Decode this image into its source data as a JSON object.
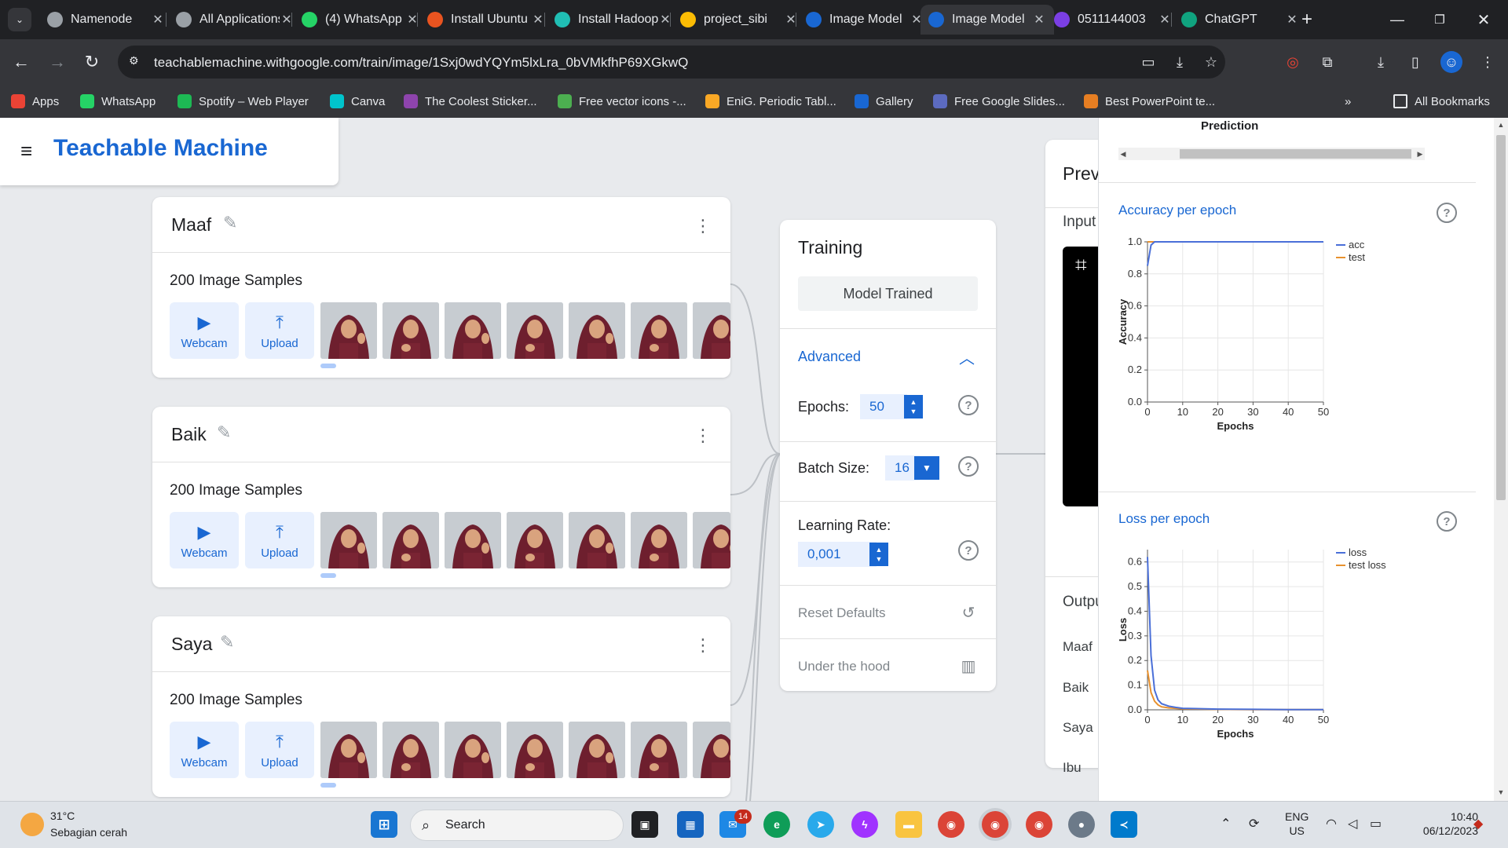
{
  "browser": {
    "tabs": [
      {
        "title": "Namenode",
        "favicon": "globe-icon",
        "color": "#9aa0a6"
      },
      {
        "title": "All Applications",
        "favicon": "globe-icon",
        "color": "#9aa0a6"
      },
      {
        "title": "(4) WhatsApp",
        "favicon": "whatsapp-icon",
        "color": "#25d366"
      },
      {
        "title": "Install Ubuntu",
        "favicon": "ubuntu-icon",
        "color": "#e95420"
      },
      {
        "title": "Install Hadoop",
        "favicon": "k-icon",
        "color": "#20beb4"
      },
      {
        "title": "project_sibi",
        "favicon": "drive-icon",
        "color": "#fbbc04"
      },
      {
        "title": "Image Model",
        "favicon": "tm-icon",
        "color": "#1967d2"
      },
      {
        "title": "Image Model",
        "favicon": "tm-icon",
        "color": "#1967d2"
      },
      {
        "title": "0511144003",
        "favicon": "plus-icon",
        "color": "#7b3fe4"
      },
      {
        "title": "ChatGPT",
        "favicon": "chatgpt-icon",
        "color": "#10a37f"
      }
    ],
    "active_tab_index": 7,
    "url": "teachablemachine.withgoogle.com/train/image/1Sxj0wdYQYm5lxLra_0bVMkfhP69XGkwQ",
    "bookmarks": [
      {
        "label": "Apps",
        "color": "#ea4335"
      },
      {
        "label": "WhatsApp",
        "color": "#25d366"
      },
      {
        "label": "Spotify – Web Player",
        "color": "#1db954"
      },
      {
        "label": "Canva",
        "color": "#00c4cc"
      },
      {
        "label": "The Coolest Sticker...",
        "color": "#8e44ad"
      },
      {
        "label": "Free vector icons -...",
        "color": "#4caf50"
      },
      {
        "label": "EniG. Periodic Tabl...",
        "color": "#f9a825"
      },
      {
        "label": "Gallery",
        "color": "#1967d2"
      },
      {
        "label": "Free Google Slides...",
        "color": "#5c6bc0"
      },
      {
        "label": "Best PowerPoint te...",
        "color": "#e67e22"
      }
    ],
    "all_bookmarks": "All Bookmarks"
  },
  "app": {
    "brand": "Teachable Machine",
    "accent": "#1967d2"
  },
  "classes": [
    {
      "name": "Maaf",
      "samples": "200 Image Samples",
      "webcam": "Webcam",
      "upload": "Upload"
    },
    {
      "name": "Baik",
      "samples": "200 Image Samples",
      "webcam": "Webcam",
      "upload": "Upload"
    },
    {
      "name": "Saya",
      "samples": "200 Image Samples",
      "webcam": "Webcam",
      "upload": "Upload"
    }
  ],
  "training": {
    "title": "Training",
    "model_status": "Model Trained",
    "advanced": "Advanced",
    "epochs_label": "Epochs:",
    "epochs_value": "50",
    "batch_label": "Batch Size:",
    "batch_value": "16",
    "lr_label": "Learning Rate:",
    "lr_value": "0,001",
    "reset": "Reset Defaults",
    "under_hood": "Under the hood"
  },
  "preview": {
    "title": "Preview",
    "input": "Input",
    "output": "Output",
    "classes": [
      "Maaf",
      "Baik",
      "Saya",
      "Ibu"
    ]
  },
  "hood": {
    "prediction_label": "Prediction"
  },
  "chart_data": [
    {
      "type": "line",
      "title": "Accuracy per epoch",
      "xlabel": "Epochs",
      "ylabel": "Accuracy",
      "xlim": [
        0,
        50
      ],
      "ylim": [
        0,
        1.0
      ],
      "xticks": [
        "0",
        "10",
        "20",
        "30",
        "40",
        "50"
      ],
      "yticks": [
        "0.0",
        "0.2",
        "0.4",
        "0.6",
        "0.8",
        "1.0"
      ],
      "grid": true,
      "legend_position": "right",
      "series": [
        {
          "name": "acc",
          "color": "#4a6fd8",
          "x": [
            0,
            1,
            2,
            3,
            5,
            10,
            20,
            30,
            40,
            50
          ],
          "values": [
            0.85,
            0.98,
            1.0,
            1.0,
            1.0,
            1.0,
            1.0,
            1.0,
            1.0,
            1.0
          ]
        },
        {
          "name": "test",
          "color": "#e8912e",
          "x": [
            0,
            1,
            2,
            3,
            5,
            10,
            20,
            30,
            40,
            50
          ],
          "values": [
            1.0,
            1.0,
            1.0,
            1.0,
            1.0,
            1.0,
            1.0,
            1.0,
            1.0,
            1.0
          ]
        }
      ]
    },
    {
      "type": "line",
      "title": "Loss per epoch",
      "xlabel": "Epochs",
      "ylabel": "Loss",
      "xlim": [
        0,
        50
      ],
      "ylim": [
        0,
        0.65
      ],
      "xticks": [
        "0",
        "10",
        "20",
        "30",
        "40",
        "50"
      ],
      "yticks": [
        "0.0",
        "0.1",
        "0.2",
        "0.3",
        "0.4",
        "0.5",
        "0.6"
      ],
      "grid": true,
      "legend_position": "right",
      "series": [
        {
          "name": "loss",
          "color": "#4a6fd8",
          "x": [
            0,
            1,
            2,
            3,
            4,
            6,
            8,
            10,
            20,
            30,
            40,
            50
          ],
          "values": [
            0.62,
            0.22,
            0.08,
            0.04,
            0.025,
            0.015,
            0.01,
            0.006,
            0.003,
            0.002,
            0.001,
            0.001
          ]
        },
        {
          "name": "test loss",
          "color": "#e8912e",
          "x": [
            0,
            1,
            2,
            3,
            4,
            6,
            8,
            10,
            20,
            30,
            40,
            50
          ],
          "values": [
            0.16,
            0.07,
            0.035,
            0.02,
            0.012,
            0.008,
            0.006,
            0.004,
            0.002,
            0.001,
            0.001,
            0.001
          ]
        }
      ]
    }
  ],
  "taskbar": {
    "temperature": "31°C",
    "condition": "Sebagian cerah",
    "search": "Search",
    "mail_badge": "14",
    "lang": "ENG",
    "region": "US",
    "time": "10:40",
    "date": "06/12/2023"
  }
}
